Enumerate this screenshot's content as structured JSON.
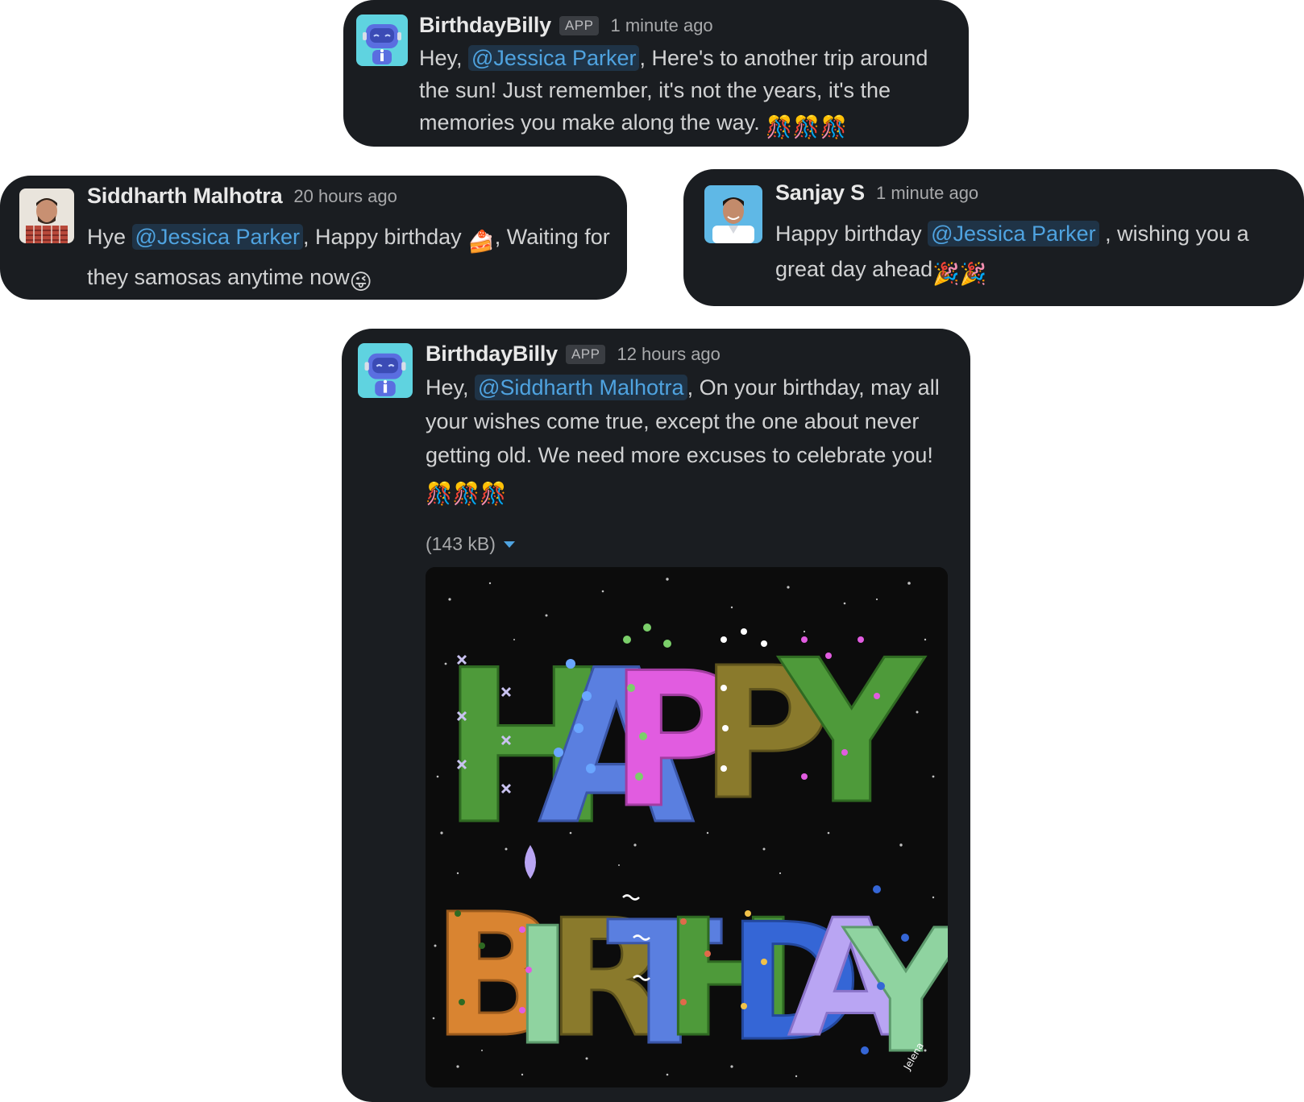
{
  "messages": [
    {
      "author": "BirthdayBilly",
      "badge": "APP",
      "time": "1 minute ago",
      "text_before": "Hey, ",
      "mention": "@Jessica Parker",
      "text_after": ", Here's to another trip around the sun! Just remember, it's not the years, it's the memories you make along the way.",
      "emoji": "🎊🎊🎊"
    },
    {
      "author": "Siddharth Malhotra",
      "time": "20 hours ago",
      "text_before": "Hye ",
      "mention": "@Jessica Parker",
      "text_middle": ", Happy birthday ",
      "emoji_1": "🍰",
      "text_after": ", Waiting for they samosas anytime now",
      "emoji_2": "😜"
    },
    {
      "author": "Sanjay S",
      "time": "1 minute ago",
      "text_before": "Happy birthday ",
      "mention": "@Jessica Parker",
      "text_after": " , wishing you a great day ahead",
      "emoji": "🎉🎉"
    },
    {
      "author": "BirthdayBilly",
      "badge": "APP",
      "time": "12 hours ago",
      "text_before": "Hey, ",
      "mention": "@Siddharth Malhotra",
      "text_after": ", On your birthday, may all your wishes come true, except the one about never getting old. We need more excuses to celebrate you!",
      "emoji": "🎊🎊🎊",
      "file_size": "(143 kB)",
      "image": {
        "line1": "HAPPY",
        "line2": "BIRTHDAY",
        "signature": "Jelena"
      }
    }
  ],
  "colors": {
    "card_bg": "#1a1d21",
    "mention": "#4fa3e0",
    "mention_bg": "#1f3346",
    "letter_green": "#4e9a3a",
    "letter_blue": "#5a7fe0",
    "letter_pink": "#e15ce0",
    "letter_olive": "#8a7a2c",
    "letter_orange": "#d98431",
    "letter_lavender": "#b9a5f3",
    "letter_mint": "#8fd3a0"
  }
}
